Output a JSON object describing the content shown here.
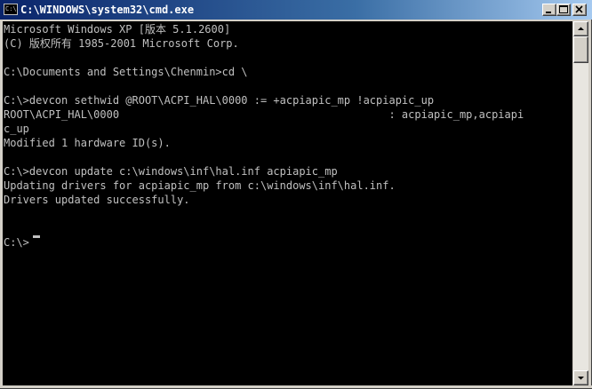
{
  "window": {
    "title": "C:\\WINDOWS\\system32\\cmd.exe",
    "icon_text": "C:\\",
    "icons": {
      "app": "cmd-icon",
      "minimize": "minimize-icon",
      "maximize": "maximize-icon",
      "close": "close-icon"
    }
  },
  "console": {
    "lines": [
      "Microsoft Windows XP [版本 5.1.2600]",
      "(C) 版权所有 1985-2001 Microsoft Corp.",
      "",
      "C:\\Documents and Settings\\Chenmin>cd \\",
      "",
      "C:\\>devcon sethwid @ROOT\\ACPI_HAL\\0000 := +acpiapic_mp !acpiapic_up",
      "ROOT\\ACPI_HAL\\0000                                          : acpiapic_mp,acpiapi",
      "c_up",
      "Modified 1 hardware ID(s).",
      "",
      "C:\\>devcon update c:\\windows\\inf\\hal.inf acpiapic_mp",
      "Updating drivers for acpiapic_mp from c:\\windows\\inf\\hal.inf.",
      "Drivers updated successfully.",
      "",
      "",
      "C:\\>"
    ],
    "text_color": "#c0c0c0",
    "background_color": "#000000"
  },
  "scrollbar": {
    "up_icon": "scroll-up-arrow-icon",
    "down_icon": "scroll-down-arrow-icon"
  }
}
